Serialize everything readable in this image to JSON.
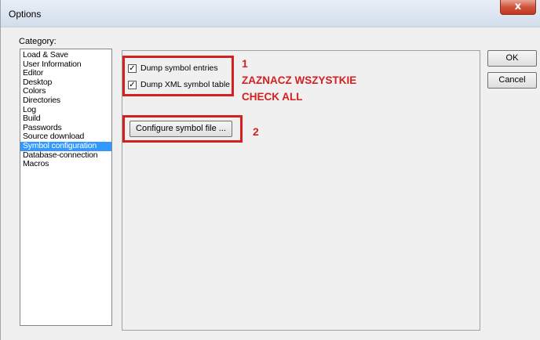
{
  "window": {
    "title": "Options",
    "close_label": "x"
  },
  "category": {
    "label": "Category:",
    "items": [
      {
        "label": "Load & Save",
        "selected": false
      },
      {
        "label": "User Information",
        "selected": false
      },
      {
        "label": "Editor",
        "selected": false
      },
      {
        "label": "Desktop",
        "selected": false
      },
      {
        "label": "Colors",
        "selected": false
      },
      {
        "label": "Directories",
        "selected": false
      },
      {
        "label": "Log",
        "selected": false
      },
      {
        "label": "Build",
        "selected": false
      },
      {
        "label": "Passwords",
        "selected": false
      },
      {
        "label": "Source download",
        "selected": false
      },
      {
        "label": "Symbol configuration",
        "selected": true
      },
      {
        "label": "Database-connection",
        "selected": false
      },
      {
        "label": "Macros",
        "selected": false
      }
    ]
  },
  "symbol_config": {
    "dump_entries": {
      "label": "Dump symbol entries",
      "checked": true,
      "mark": "✓"
    },
    "dump_xml": {
      "label": "Dump XML symbol table",
      "checked": true,
      "mark": "✓"
    },
    "configure_label": "Configure symbol file ..."
  },
  "annotations": {
    "num1": "1",
    "line1": "ZAZNACZ WSZYSTKIE",
    "line2": "CHECK ALL",
    "num2": "2",
    "color": "#d42020"
  },
  "buttons": {
    "ok": "OK",
    "cancel": "Cancel"
  }
}
